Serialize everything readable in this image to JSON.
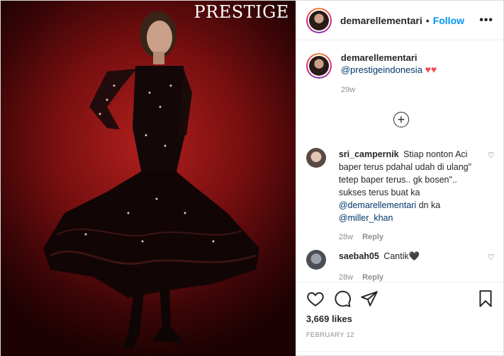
{
  "photo": {
    "magazine": "PRESTIGE"
  },
  "header": {
    "username": "demarellementari",
    "separator": "•",
    "follow_label": "Follow",
    "more_icon": "more-options-icon"
  },
  "caption": {
    "username": "demarellementari",
    "mention": "@prestigeindonesia",
    "hearts": "♥♥",
    "time": "29w"
  },
  "load_more_icon": "plus-circle-icon",
  "comments": [
    {
      "username": "sri_campernik",
      "text": "Stiap nonton Aci baper terus pdahal udah di ulang\" tetep baper terus.. gk bosen\".. sukses terus buat ka",
      "mention1": "@demarellementari",
      "mid": "dn ka",
      "mention2": "@miller_khan",
      "time": "28w",
      "reply": "Reply"
    },
    {
      "username": "saebah05",
      "text": "Cantik🖤",
      "time": "28w",
      "reply": "Reply"
    }
  ],
  "actions": {
    "likes": "3,669 likes",
    "date": "FEBRUARY 12",
    "icons": [
      "heart-icon",
      "comment-icon",
      "share-icon",
      "bookmark-icon"
    ]
  },
  "colors": {
    "link_blue": "#0095f6",
    "mention": "#00376b",
    "muted": "#8e8e8e",
    "heart_red": "#ed4956",
    "photo_red": "#b0201d"
  }
}
